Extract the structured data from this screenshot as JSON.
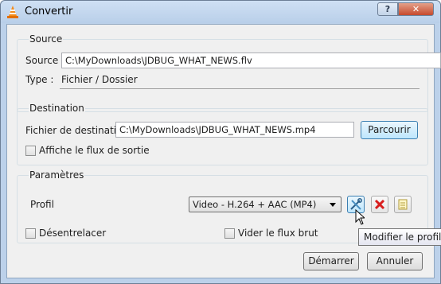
{
  "window": {
    "title": "Convertir",
    "help_label": "?",
    "close_label": "✕"
  },
  "source": {
    "group_title": "Source",
    "source_label": "Source :",
    "source_value": "C:\\MyDownloads\\JDBUG_WHAT_NEWS.flv",
    "type_label": "Type :",
    "type_value": "Fichier / Dossier"
  },
  "destination": {
    "group_title": "Destination",
    "file_label": "Fichier de destination :",
    "file_value": "C:\\MyDownloads\\JDBUG_WHAT_NEWS.mp4",
    "browse_label": "Parcourir",
    "show_output_label": "Affiche le flux de sortie",
    "show_output_checked": false
  },
  "parameters": {
    "group_title": "Paramètres",
    "profile_label": "Profil",
    "profile_selected": "Video - H.264 + AAC (MP4)",
    "deinterlace_label": "Désentrelacer",
    "deinterlace_checked": false,
    "dump_raw_label": "Vider le flux brut",
    "dump_raw_checked": false
  },
  "tooltip": {
    "text": "Modifier le profil s"
  },
  "footer": {
    "start_label": "Démarrer",
    "cancel_label": "Annuler"
  },
  "icons": {
    "app": "vlc-cone-icon",
    "edit_profile": "wrench-screwdriver-icon",
    "delete_profile": "red-x-icon",
    "new_profile": "new-document-icon"
  },
  "colors": {
    "titlebar": "#b9cfe9",
    "close_button": "#c64a2d",
    "focus_button": "#bee6fd",
    "delete_icon": "#d81e1e"
  }
}
